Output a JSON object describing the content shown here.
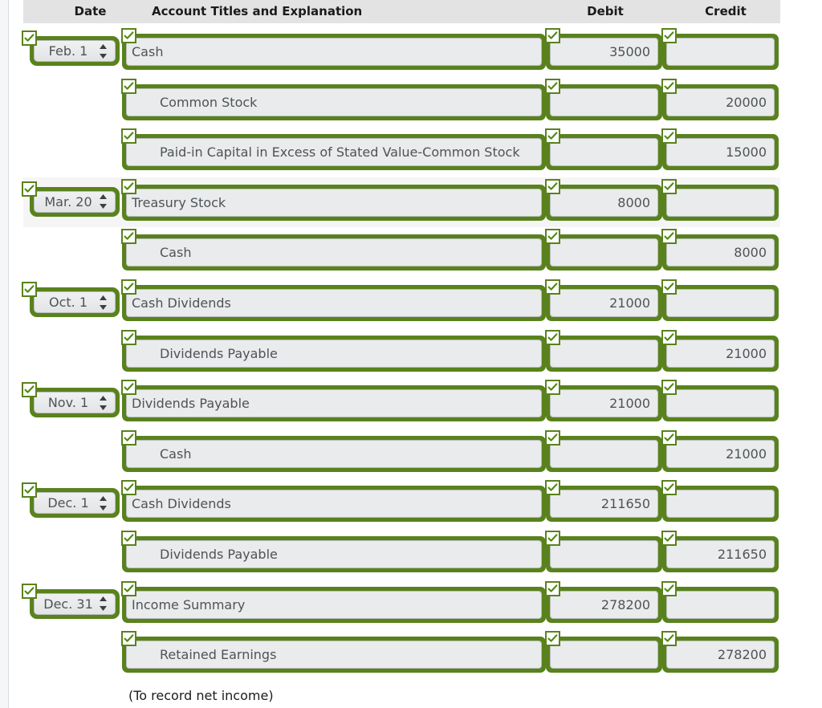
{
  "table": {
    "headers": {
      "date": "Date",
      "account": "Account Titles and Explanation",
      "debit": "Debit",
      "credit": "Credit"
    },
    "rows": [
      {
        "date": "Feb. 1",
        "account": "Cash",
        "indent": false,
        "debit": "35000",
        "credit": "",
        "stripe": false
      },
      {
        "date": "",
        "account": "Common Stock",
        "indent": true,
        "debit": "",
        "credit": "20000",
        "stripe": false
      },
      {
        "date": "",
        "account": "Paid-in Capital in Excess of Stated Value-Common Stock",
        "indent": true,
        "debit": "",
        "credit": "15000",
        "stripe": false
      },
      {
        "date": "Mar. 20",
        "account": "Treasury Stock",
        "indent": false,
        "debit": "8000",
        "credit": "",
        "stripe": true
      },
      {
        "date": "",
        "account": "Cash",
        "indent": true,
        "debit": "",
        "credit": "8000",
        "stripe": false
      },
      {
        "date": "Oct. 1",
        "account": "Cash Dividends",
        "indent": false,
        "debit": "21000",
        "credit": "",
        "stripe": false
      },
      {
        "date": "",
        "account": "Dividends Payable",
        "indent": true,
        "debit": "",
        "credit": "21000",
        "stripe": false
      },
      {
        "date": "Nov. 1",
        "account": "Dividends Payable",
        "indent": false,
        "debit": "21000",
        "credit": "",
        "stripe": false
      },
      {
        "date": "",
        "account": "Cash",
        "indent": true,
        "debit": "",
        "credit": "21000",
        "stripe": false
      },
      {
        "date": "Dec. 1",
        "account": "Cash Dividends",
        "indent": false,
        "debit": "211650",
        "credit": "",
        "stripe": false
      },
      {
        "date": "",
        "account": "Dividends Payable",
        "indent": true,
        "debit": "",
        "credit": "211650",
        "stripe": false
      },
      {
        "date": "Dec. 31",
        "account": "Income Summary",
        "indent": false,
        "debit": "278200",
        "credit": "",
        "stripe": false
      },
      {
        "date": "",
        "account": "Retained Earnings",
        "indent": true,
        "debit": "",
        "credit": "278200",
        "stripe": false
      }
    ],
    "footer_note": "(To record net income)"
  },
  "icons": {
    "validated_check": "check-icon",
    "stepper": "spinner-arrows-icon"
  },
  "colors": {
    "validated_border": "#59821c",
    "field_fill": "#e9ebec",
    "header_fill": "#e3e3e3",
    "stripe_fill": "#f5f5f5",
    "text": "#4f5356"
  }
}
